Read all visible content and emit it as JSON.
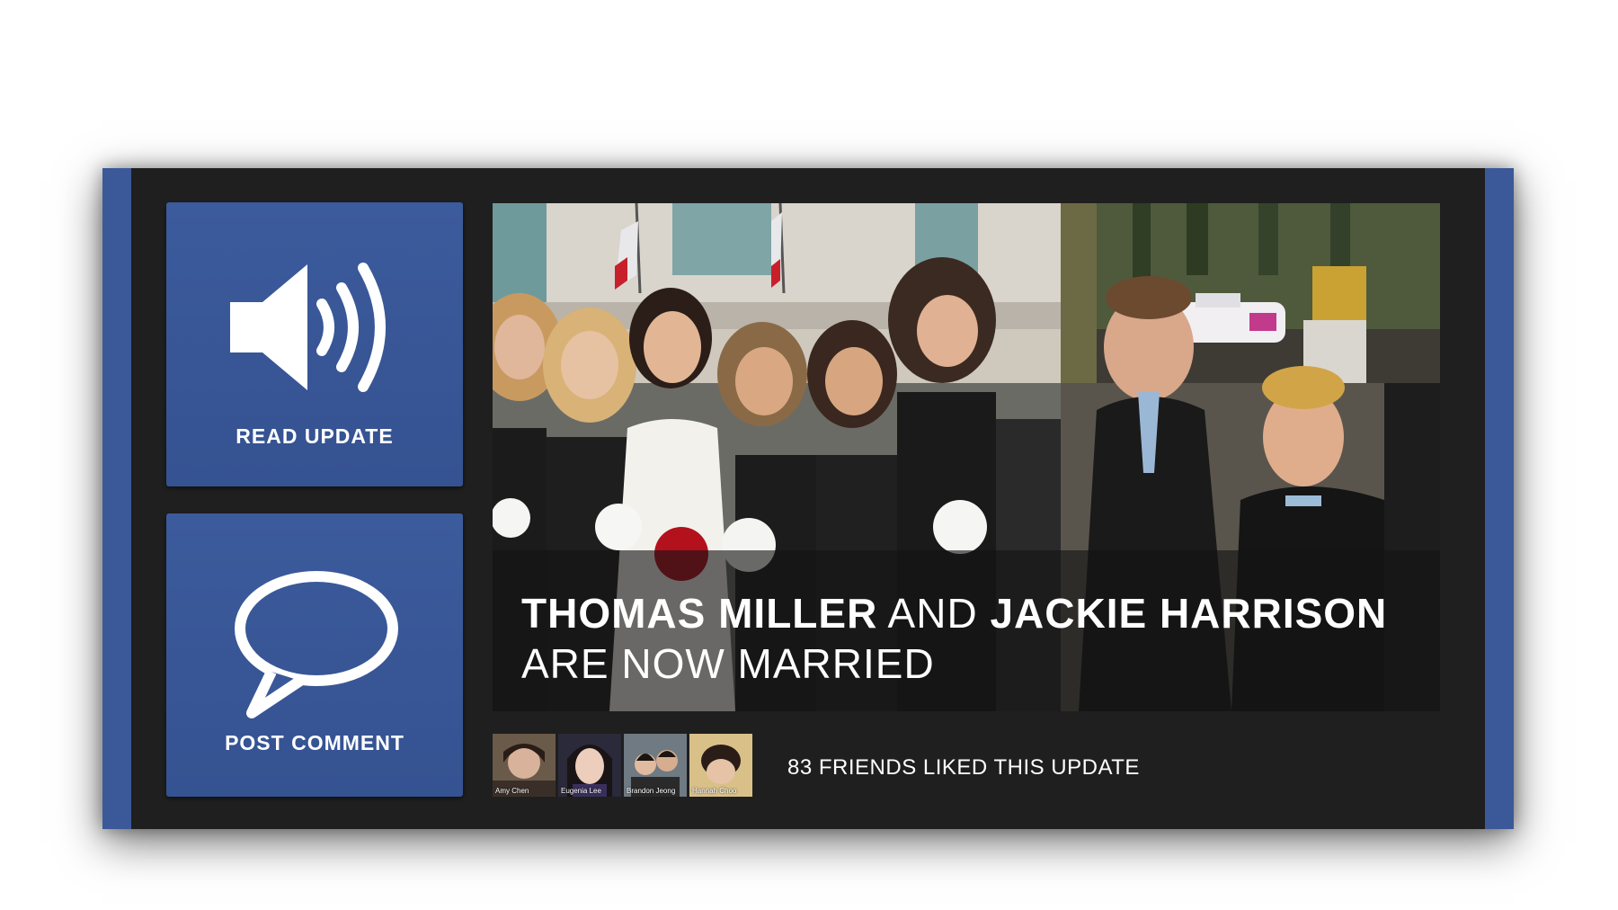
{
  "tiles": {
    "read_update": {
      "label": "READ UPDATE",
      "icon": "speaker-icon"
    },
    "post_comment": {
      "label": "POST COMMENT",
      "icon": "speech-bubble-icon"
    }
  },
  "update": {
    "name1": "THOMAS MILLER",
    "and": "AND",
    "name2": "JACKIE HARRISON",
    "line2": "ARE NOW MARRIED"
  },
  "friends": [
    {
      "name": "Amy Chen"
    },
    {
      "name": "Eugenia Lee"
    },
    {
      "name": "Brandon Jeong"
    },
    {
      "name": "Hannah Choo"
    }
  ],
  "likes_text": "83 FRIENDS LIKED THIS UPDATE",
  "colors": {
    "accent": "#3b5998",
    "background": "#1f1f1f"
  }
}
